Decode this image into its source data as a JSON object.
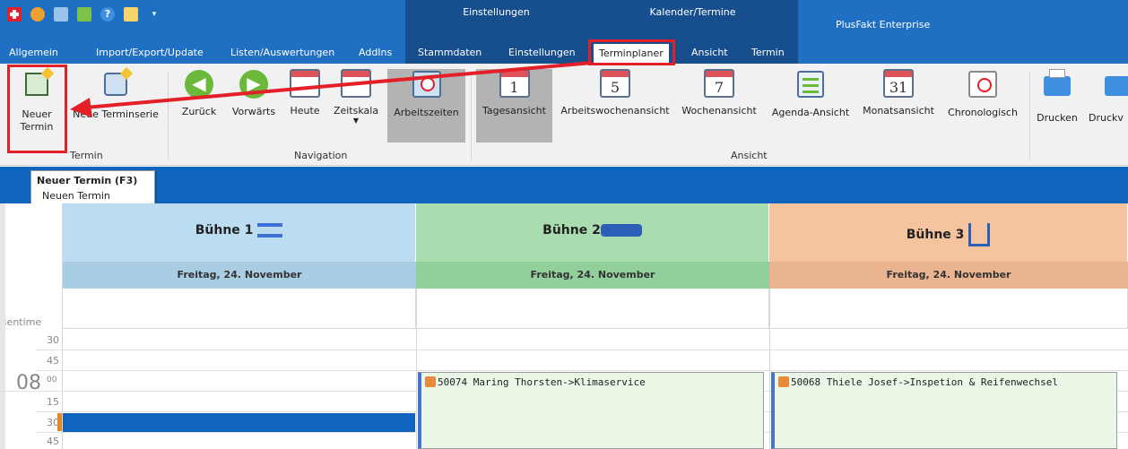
{
  "titlebar": {
    "context_groups": [
      {
        "title": "Einstellungen"
      },
      {
        "title": "Kalender/Termine"
      }
    ],
    "app_title": "PlusFakt Enterprise",
    "qat_icons": [
      "swiss-cross-icon",
      "people-icon",
      "image-icon",
      "puzzle-icon",
      "help-icon",
      "window-icon",
      "dropdown-arrow-icon"
    ]
  },
  "tabs": [
    {
      "label": "Allgemein"
    },
    {
      "label": "Import/Export/Update"
    },
    {
      "label": "Listen/Auswertungen"
    },
    {
      "label": "AddIns"
    },
    {
      "label": "Stammdaten"
    },
    {
      "label": "Einstellungen"
    },
    {
      "label": "Terminplaner"
    },
    {
      "label": "Ansicht"
    },
    {
      "label": "Termin"
    }
  ],
  "ribbon": {
    "termin": {
      "group_label": "Termin",
      "neuer_termin": "Neuer\nTermin",
      "neue_terminserie": "Neue Terminserie"
    },
    "navigation": {
      "group_label": "Navigation",
      "zurueck": "Zurück",
      "vorwaerts": "Vorwärts",
      "heute": "Heute",
      "zeitskala": "Zeitskala",
      "arbeitszeiten": "Arbeitszeiten"
    },
    "ansicht": {
      "group_label": "Ansicht",
      "tagesansicht": "Tagesansicht",
      "tagesansicht_num": "1",
      "arbeitswochenansicht": "Arbeitswochenansicht",
      "arbeitswochenansicht_num": "5",
      "wochenansicht": "Wochenansicht",
      "wochenansicht_num": "7",
      "agenda": "Agenda-Ansicht",
      "monatsansicht": "Monatsansicht",
      "monatsansicht_num": "31",
      "chronologisch": "Chronologisch"
    },
    "drucken": "Drucken",
    "druck2": "Druckv"
  },
  "tooltip": {
    "title": "Neuer Termin (F3)",
    "text": "Neuen Termin anlegen."
  },
  "calendar": {
    "time_header": "Bentime",
    "resources": [
      {
        "name": "Bühne 1",
        "date": "Freitag, 24. November",
        "color": "#bcdcf2",
        "date_color": "#a9cde3"
      },
      {
        "name": "Bühne 2",
        "date": "Freitag, 24. November",
        "color": "#a9ddb0",
        "date_color": "#93cf9b"
      },
      {
        "name": "Bühne 3",
        "date": "Freitag, 24. November",
        "color": "#f6c39f",
        "date_color": "#e9b48f"
      }
    ],
    "times": [
      {
        "hour": "",
        "min": "30"
      },
      {
        "hour": "",
        "min": "45"
      },
      {
        "hour": "08",
        "min": "00"
      },
      {
        "hour": "",
        "min": "15"
      },
      {
        "hour": "",
        "min": "30"
      },
      {
        "hour": "",
        "min": "45"
      }
    ],
    "appointments": [
      {
        "text": "50074 Maring Thorsten->Klimaservice"
      },
      {
        "text": "50068 Thiele Josef->Inspetion & Reifenwechsel"
      }
    ]
  }
}
